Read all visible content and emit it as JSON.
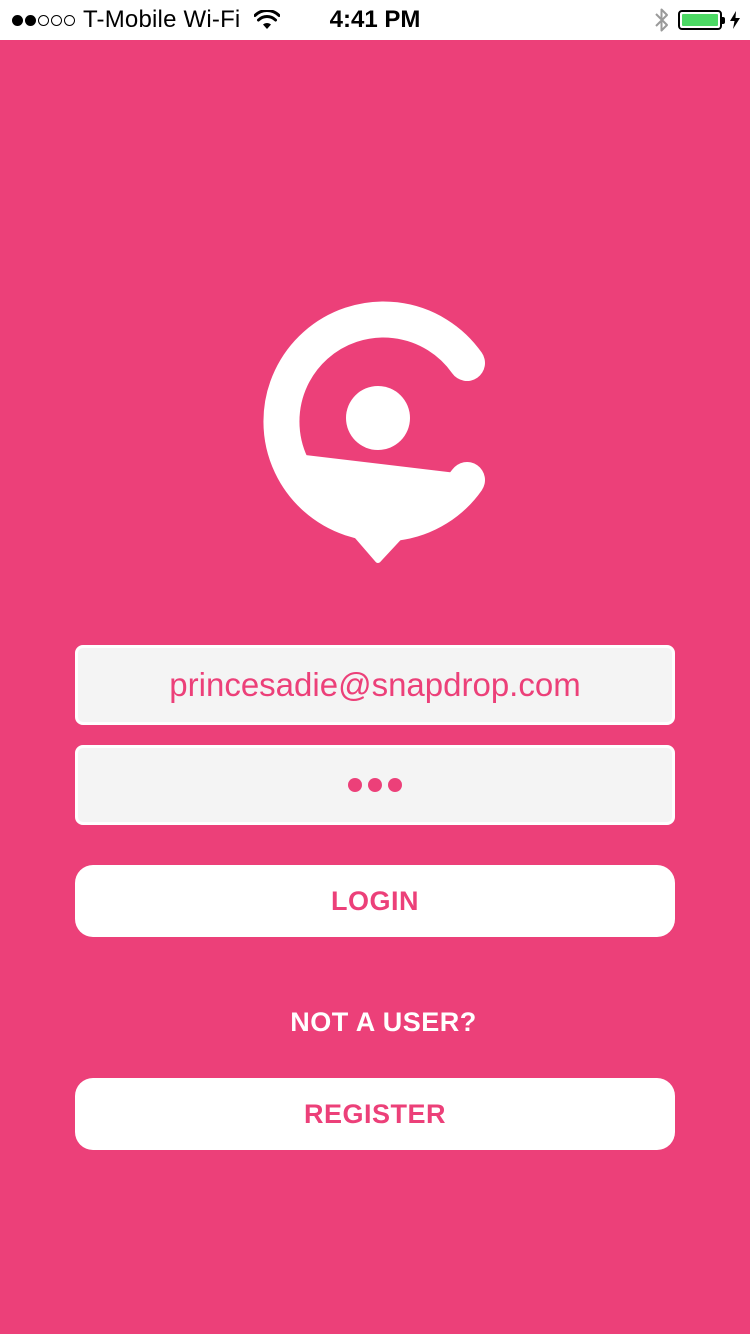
{
  "status_bar": {
    "signal_bars_filled": 2,
    "signal_bars_total": 5,
    "carrier": "T-Mobile Wi-Fi",
    "time": "4:41 PM",
    "battery_level": 1.0,
    "icons": [
      "wifi-icon",
      "bluetooth-icon",
      "battery-icon",
      "charging-bolt-icon"
    ]
  },
  "logo": {
    "icon": "location-pin-c-logo-icon"
  },
  "login_form": {
    "email_value": "princesadie@snapdrop.com",
    "password_masked": "•••",
    "password_length": 3,
    "login_label": "LOGIN",
    "not_user_label": "NOT A USER?",
    "register_label": "REGISTER"
  },
  "colors": {
    "brand": "#EC4079",
    "field_background": "#F4F4F4",
    "battery_green": "#4CD964"
  }
}
